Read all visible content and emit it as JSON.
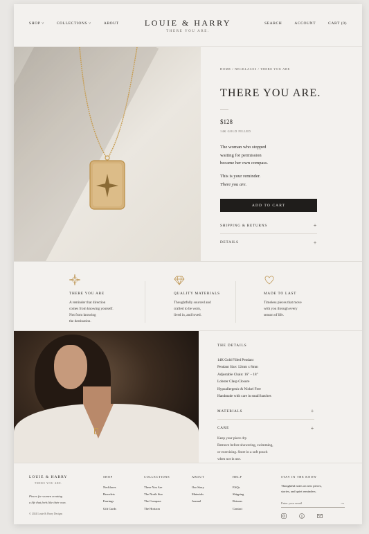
{
  "header": {
    "nav_left": [
      "SHOP",
      "COLLECTIONS",
      "ABOUT"
    ],
    "brand": "LOUIE & HARRY",
    "tagline": "THERE YOU ARE.",
    "nav_right": [
      "SEARCH",
      "ACCOUNT",
      "CART (0)"
    ]
  },
  "product": {
    "breadcrumb": "HOME / NECKLACES / THERE YOU ARE",
    "title": "THERE YOU ARE.",
    "price": "$128",
    "metal": "14K GOLD FILLED",
    "desc": [
      "The woman who stopped",
      "waiting for permission",
      "became her own compass."
    ],
    "desc2": "This is your reminder.",
    "desc3": "There you are.",
    "cart": "ADD TO CART",
    "acc1": "SHIPPING & RETURNS",
    "acc2": "DETAILS",
    "plus": "+"
  },
  "features": [
    {
      "title": "THERE YOU ARE",
      "lines": [
        "A reminder that direction",
        "comes from knowing yourself.",
        "Not from knowing",
        "the destination."
      ],
      "icon": "compass-star-icon"
    },
    {
      "title": "QUALITY MATERIALS",
      "lines": [
        "Thoughtfully sourced and",
        "crafted to be worn,",
        "lived in, and loved."
      ],
      "icon": "diamond-icon"
    },
    {
      "title": "MADE TO LAST",
      "lines": [
        "Timeless pieces that move",
        "with you through every",
        "season of life."
      ],
      "icon": "heart-icon"
    }
  ],
  "details": {
    "heading": "THE DETAILS",
    "lines": [
      "14K Gold Filled Pendant",
      "Pendant Size: 12mm x 8mm",
      "Adjustable Chain: 16\" – 18\"",
      "Lobster Clasp Closure",
      "Hypoallergenic & Nickel Free",
      "Handmade with care in small batches"
    ],
    "materials": "MATERIALS",
    "care": "CARE",
    "care_lines": [
      "Keep your piece dry.",
      "Remove before showering, swimming,",
      "or exercising. Store in a soft pouch",
      "when not in use."
    ]
  },
  "footer": {
    "brand": "LOUIE & HARRY",
    "tagline": "THERE YOU ARE.",
    "blurb": [
      "Pieces for women creating",
      "a life that feels like their own."
    ],
    "copyright": "© 2024 Louie & Harry Designs",
    "cols": [
      {
        "h": "SHOP",
        "l": [
          "Necklaces",
          "Bracelets",
          "Earrings",
          "Gift Cards"
        ]
      },
      {
        "h": "COLLECTIONS",
        "l": [
          "There You Are",
          "The North Star",
          "The Compass",
          "The Horizon"
        ]
      },
      {
        "h": "ABOUT",
        "l": [
          "Our Story",
          "Materials",
          "Journal"
        ]
      },
      {
        "h": "HELP",
        "l": [
          "FAQs",
          "Shipping",
          "Returns",
          "Contact"
        ]
      }
    ],
    "nl_h": "STAY IN THE KNOW",
    "nl_b": [
      "Thoughtful notes on new pieces,",
      "stories, and quiet reminders."
    ],
    "nl_ph": "Enter your email",
    "nl_arrow": "→"
  },
  "colors": {
    "bg": "#f3f1ee",
    "ink": "#2a2724",
    "button": "#1f1d1b",
    "gold": "#c79d52"
  }
}
